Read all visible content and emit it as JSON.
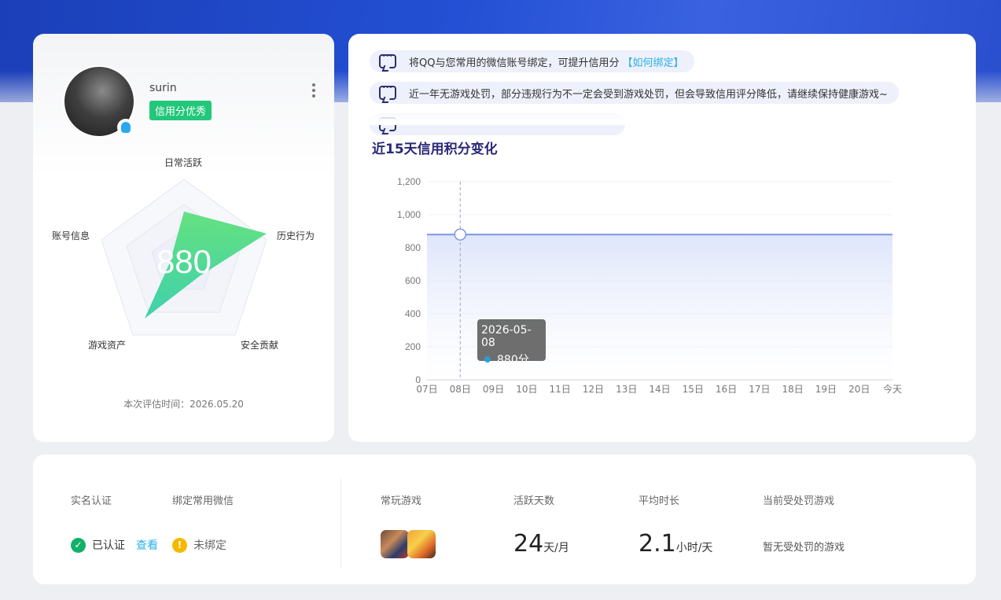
{
  "profile": {
    "username": "surin",
    "credit_tag": "信用分优秀",
    "score": "880",
    "radar_labels": [
      "日常活跃",
      "历史行为",
      "安全贡献",
      "游戏资产",
      "账号信息"
    ],
    "eval_time": "本次评估时间：2026.05.20"
  },
  "notices": [
    {
      "text": "将QQ与您常用的微信账号绑定，可提升信用分",
      "link": "【如何绑定】"
    },
    {
      "text": "近一年无游戏处罚，部分违规行为不一定会受到游戏处罚，但会导致信用评分降低，请继续保持健康游戏~",
      "link": ""
    }
  ],
  "trend": {
    "title": "近15天信用积分变化",
    "tooltip_date": "2026-05-08",
    "tooltip_value": "880分"
  },
  "chart_data": {
    "type": "area",
    "title": "近15天信用积分变化",
    "categories": [
      "07日",
      "08日",
      "09日",
      "10日",
      "11日",
      "12日",
      "13日",
      "14日",
      "15日",
      "16日",
      "17日",
      "18日",
      "19日",
      "20日",
      "今天"
    ],
    "series": [
      {
        "values": [
          880,
          880,
          880,
          880,
          880,
          880,
          880,
          880,
          880,
          880,
          880,
          880,
          880,
          880,
          880
        ]
      }
    ],
    "yticks": [
      "0",
      "200",
      "400",
      "600",
      "800",
      "1,000",
      "1,200"
    ],
    "ylim": [
      0,
      1200
    ],
    "highlight_index": 1,
    "color": "#7b96e0"
  },
  "stats": {
    "realname_label": "实名认证",
    "wechat_label": "绑定常用微信",
    "realname_status": "已认证",
    "view_link": "查看",
    "wechat_status": "未绑定",
    "games_label": "常玩游戏",
    "active_label": "活跃天数",
    "active_value": "24",
    "active_unit": "天/月",
    "avg_label": "平均时长",
    "avg_value": "2.1",
    "avg_unit": "小时/天",
    "punish_label": "当前受处罚游戏",
    "punish_value": "暂无受处罚的游戏"
  },
  "colors": {
    "accent": "#22c77a",
    "link": "#28b0e8",
    "title": "#2a2878"
  }
}
